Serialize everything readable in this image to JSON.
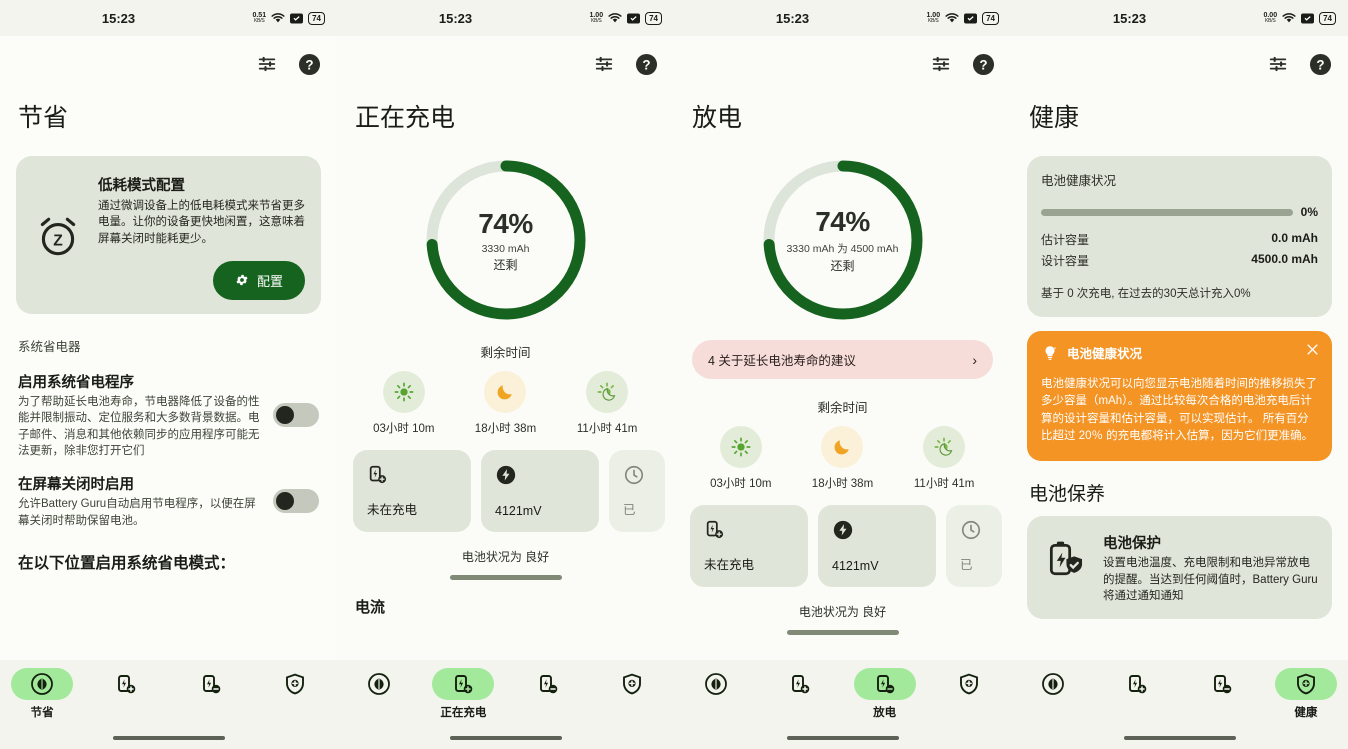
{
  "status_bar": {
    "time": "15:23",
    "battery_level": "74",
    "screens": [
      {
        "net_value": "0.51",
        "net_unit": "KB/S"
      },
      {
        "net_value": "1.00",
        "net_unit": "KB/S"
      },
      {
        "net_value": "1.00",
        "net_unit": "KB/S"
      },
      {
        "net_value": "0.00",
        "net_unit": "KB/S"
      }
    ],
    "icons": [
      "network-speed-icon",
      "wifi-icon",
      "vpn-icon",
      "battery-icon"
    ]
  },
  "appbar": {
    "settings_icon": "tune-sliders-icon",
    "help_icon": "help-circle-icon"
  },
  "colors": {
    "accent_green": "#15631f",
    "ring_track": "#dde5da",
    "nav_active": "#a3e99b",
    "card_bg": "#dfe5d8",
    "notice_orange": "#f39425",
    "advice_pink": "#f6ddd9"
  },
  "saver": {
    "title": "节省",
    "tip_card": {
      "icon": "alarm-snooze-icon",
      "title": "低耗模式配置",
      "text": "通过微调设备上的低电耗模式来节省更多电量。让你的设备更快地闲置，这意味着屏幕关闭时能耗更少。",
      "button_label": "配置",
      "button_icon": "gear-icon"
    },
    "section_label": "系统省电器",
    "prefs": [
      {
        "title": "启用系统省电程序",
        "sub": "为了帮助延长电池寿命，节电器降低了设备的性能并限制振动、定位服务和大多数背景数据。电子邮件、消息和其他依赖同步的应用程序可能无法更新，除非您打开它们",
        "enabled": false
      },
      {
        "title": "在屏幕关闭时启用",
        "sub": "允许Battery Guru自动启用节电程序，以便在屏幕关闭时帮助保留电池。",
        "enabled": false
      }
    ],
    "footer_label": "在以下位置启用系统省电模式："
  },
  "charging": {
    "title": "正在充电",
    "ring": {
      "percent_label": "74%",
      "percent_value": 74,
      "sub": "3330 mAh",
      "sub2": "还剩"
    },
    "remaining_title": "剩余时间",
    "remaining": [
      {
        "icon": "sun-icon",
        "label": "03小时 10m"
      },
      {
        "icon": "moon-icon",
        "label": "18小时 38m"
      },
      {
        "icon": "sun-moon-icon",
        "label": "11小时 41m"
      }
    ],
    "stats": [
      {
        "icon": "battery-plus-icon",
        "value": "未在充电"
      },
      {
        "icon": "bolt-circle-icon",
        "value": "4121mV"
      },
      {
        "icon": "temperature-icon",
        "value": "已"
      }
    ],
    "status_line": "电池状况为 良好",
    "next_section": "电流"
  },
  "discharging": {
    "title": "放电",
    "ring": {
      "percent_label": "74%",
      "percent_value": 74,
      "sub": "3330 mAh 为 4500 mAh",
      "sub2": "还剩"
    },
    "advice_pill": {
      "label": "4 关于延长电池寿命的建议",
      "chevron": "chevron-right-icon"
    },
    "remaining_title": "剩余时间",
    "remaining": [
      {
        "icon": "sun-icon",
        "label": "03小时 10m"
      },
      {
        "icon": "moon-icon",
        "label": "18小时 38m"
      },
      {
        "icon": "sun-moon-icon",
        "label": "11小时 41m"
      }
    ],
    "stats": [
      {
        "icon": "battery-plus-icon",
        "value": "未在充电"
      },
      {
        "icon": "bolt-circle-icon",
        "value": "4121mV"
      },
      {
        "icon": "temperature-icon",
        "value": "已"
      }
    ],
    "status_line": "电池状况为 良好"
  },
  "health": {
    "title": "健康",
    "card": {
      "title": "电池健康状况",
      "percent": "0%",
      "percent_value": 0,
      "rows": [
        {
          "label": "估计容量",
          "value": "0.0 mAh"
        },
        {
          "label": "设计容量",
          "value": "4500.0 mAh"
        }
      ],
      "footer": "基于 0 次充电, 在过去的30天总计充入0%"
    },
    "notice": {
      "icon": "lightbulb-icon",
      "title": "电池健康状况",
      "close_icon": "close-icon",
      "body": "电池健康状况可以向您显示电池随着时间的推移损失了多少容量（mAh）。通过比较每次合格的电池充电后计算的设计容量和估计容量，可以实现估计。\n所有百分比超过 20％ 的充电都将计入估算，因为它们更准确。"
    },
    "maintenance_title": "电池保养",
    "maintenance_card": {
      "icon": "battery-shield-icon",
      "title": "电池保护",
      "text": "设置电池温度、充电限制和电池异常放电的提醒。当达到任何阈值时，Battery Guru 将通过通知通知"
    }
  },
  "bottom_nav": {
    "items": [
      {
        "icon": "leaf-icon",
        "label": "节省"
      },
      {
        "icon": "battery-plus-icon",
        "label": "正在充电"
      },
      {
        "icon": "battery-minus-icon",
        "label": "放电"
      },
      {
        "icon": "shield-plus-icon",
        "label": "健康"
      }
    ],
    "active_index": [
      0,
      1,
      2,
      3
    ]
  }
}
